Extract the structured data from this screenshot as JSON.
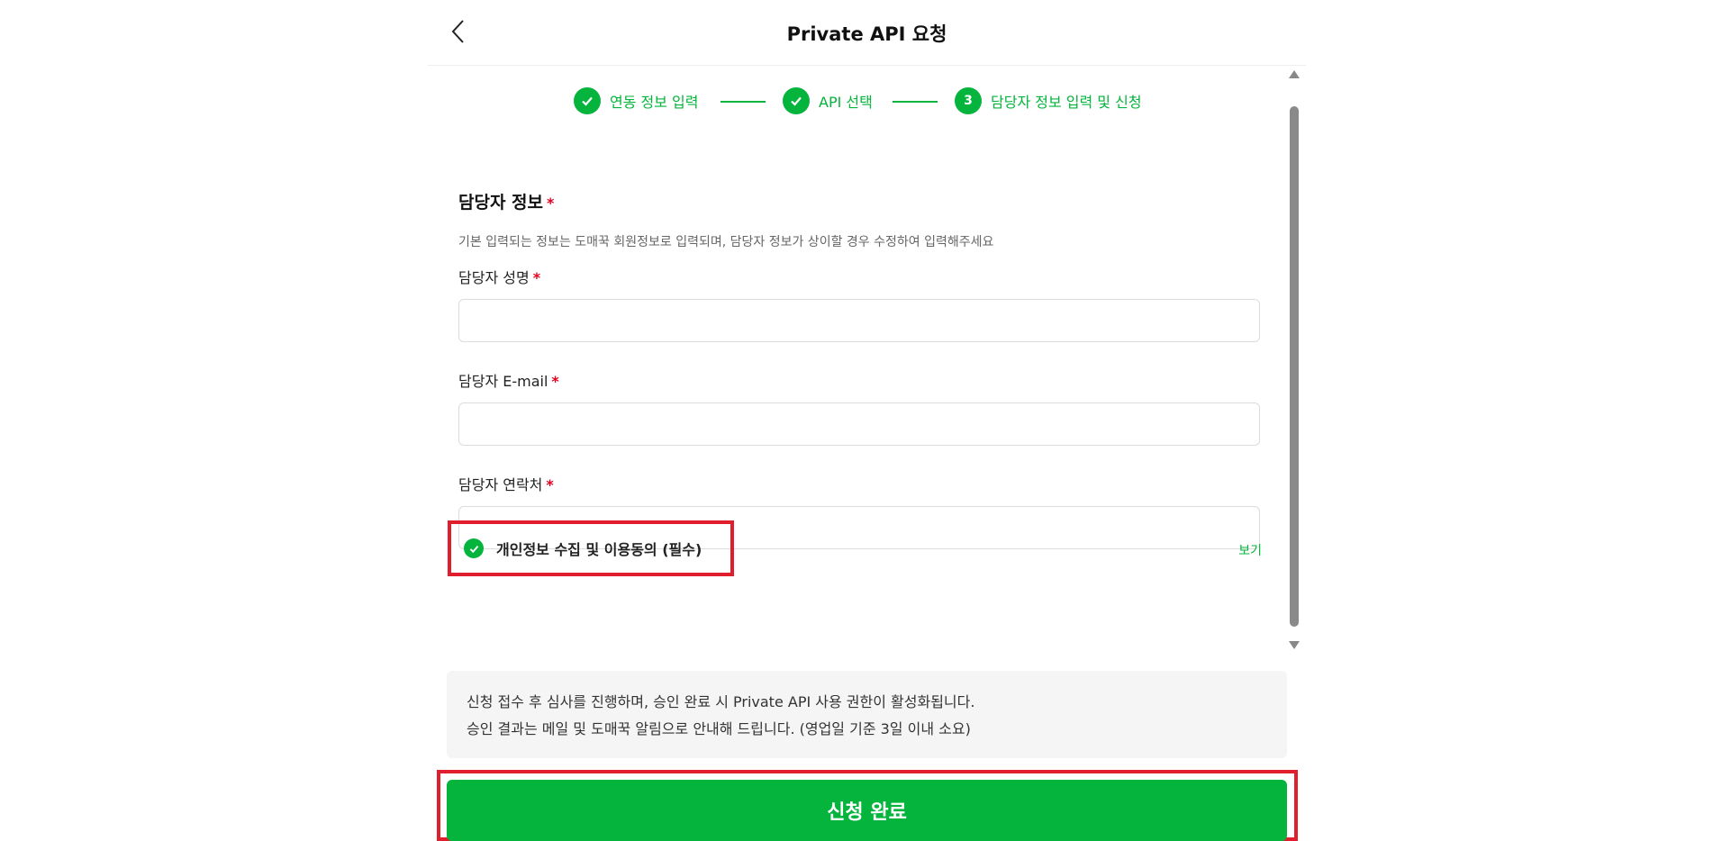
{
  "header": {
    "title": "Private API 요청"
  },
  "steps": [
    {
      "label": "연동 정보 입력",
      "state": "done"
    },
    {
      "label": "API 선택",
      "state": "done"
    },
    {
      "number": "3",
      "label": "담당자 정보 입력 및 신청",
      "state": "active"
    }
  ],
  "section": {
    "title": "담당자 정보",
    "required_mark": "*",
    "description": "기본 입력되는 정보는 도매꾹 회원정보로 입력되며, 담당자 정보가 상이할 경우 수정하여 입력해주세요"
  },
  "fields": [
    {
      "label": "담당자 성명",
      "required": "*",
      "value": "",
      "placeholder": ""
    },
    {
      "label": "담당자 E-mail",
      "required": "*",
      "value": "",
      "placeholder": ""
    },
    {
      "label": "담당자 연락처",
      "required": "*",
      "value": "",
      "placeholder": ""
    }
  ],
  "consent": {
    "label": "개인정보 수집 및 이용동의 (필수)",
    "checked": true,
    "view_label": "보기"
  },
  "notice": {
    "lines": [
      "신청 접수 후 심사를 진행하며, 승인 완료 시 Private API 사용 권한이 활성화됩니다.",
      "승인 결과는 메일 및 도매꾹 알림으로 안내해 드립니다. (영업일 기준 3일 이내 소요)"
    ]
  },
  "submit": {
    "label": "신청 완료"
  },
  "colors": {
    "accent": "#04b43c",
    "required": "#e1001e",
    "highlight": "#e01e2d"
  }
}
